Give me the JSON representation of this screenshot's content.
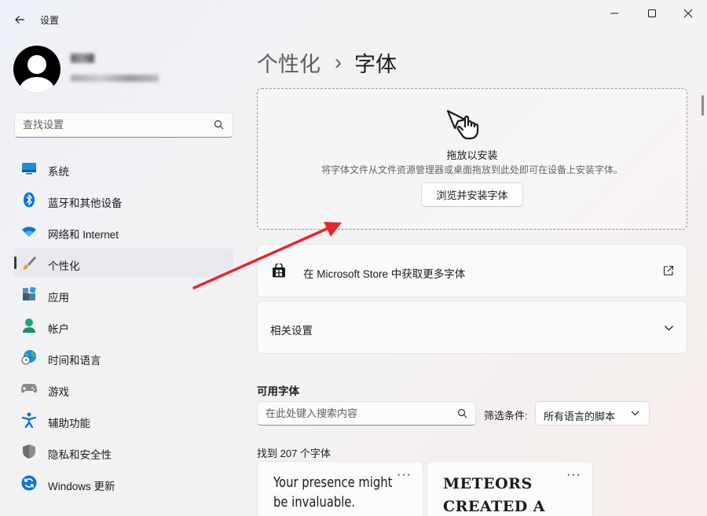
{
  "window": {
    "title": "设置",
    "controls": {
      "minimize_icon": "minimize-icon",
      "maximize_icon": "maximize-icon",
      "close_icon": "close-icon"
    }
  },
  "sidebar": {
    "search_placeholder": "查找设置",
    "items": [
      {
        "label": "系统",
        "icon": "system-monitor-icon"
      },
      {
        "label": "蓝牙和其他设备",
        "icon": "bluetooth-icon"
      },
      {
        "label": "网络和 Internet",
        "icon": "wifi-icon"
      },
      {
        "label": "个性化",
        "icon": "brush-icon",
        "active": true
      },
      {
        "label": "应用",
        "icon": "apps-icon"
      },
      {
        "label": "帐户",
        "icon": "account-icon"
      },
      {
        "label": "时间和语言",
        "icon": "globe-clock-icon"
      },
      {
        "label": "游戏",
        "icon": "gamepad-icon"
      },
      {
        "label": "辅助功能",
        "icon": "accessibility-icon"
      },
      {
        "label": "隐私和安全性",
        "icon": "shield-icon"
      },
      {
        "label": "Windows 更新",
        "icon": "update-icon"
      }
    ]
  },
  "main": {
    "breadcrumb": {
      "parent": "个性化",
      "separator": "›",
      "current": "字体"
    },
    "dropzone": {
      "title": "拖放以安装",
      "description": "将字体文件从文件资源管理器或桌面拖放到此处即可在设备上安装字体。",
      "button": "浏览并安装字体",
      "icon": "drag-hand-icon"
    },
    "store_card": {
      "label": "在 Microsoft Store 中获取更多字体",
      "icon": "store-icon",
      "action_icon": "open-external-icon"
    },
    "related_card": {
      "label": "相关设置",
      "action_icon": "chevron-down-icon"
    },
    "available_fonts": {
      "title": "可用字体",
      "search_placeholder": "在此处键入搜索内容",
      "filter_label": "筛选条件:",
      "filter_value": "所有语言的脚本",
      "found_text": "找到 207 个字体",
      "cards": [
        {
          "sample": "Your presence might be invaluable.",
          "more": "···"
        },
        {
          "sample": "METEORS CREATED A",
          "more": "···"
        }
      ]
    }
  },
  "colors": {
    "annotation_arrow": "#e8262b",
    "accent_blue": "#0067c0"
  }
}
